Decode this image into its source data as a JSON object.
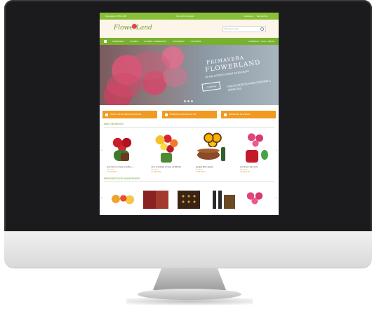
{
  "topbar": {
    "left": "Televendas (11) 5511-1000",
    "center": "Bem-vindo! Faça login",
    "right1": "Cadastre-se",
    "right2": "Meu Carrinho"
  },
  "header": {
    "logo": "FlowerLand",
    "search_placeholder": "Busque no site"
  },
  "nav": {
    "items": [
      "PRIMAVERA",
      "FLORES",
      "FLORES + PRESENTES",
      "POR PREÇO",
      "OCASIÕES"
    ],
    "right": "CARRINHO · 0 itens · R$0,00"
  },
  "banner": {
    "title1": "PRIMAVERA",
    "title2": "FLOWERLAND",
    "subtitle": "AS MELHORES FLORES DA ESTAÇÃO",
    "button": "CONFIRA",
    "side": "FRETE GRÁTIS PARA CENTRO E ZONA SUL"
  },
  "promos": [
    "FRETE GRÁTIS CENTRO E ZONA SUL",
    "PRESENTES COM ATÉ 50% OFF",
    "PRESENTES DE ATÉ 40%"
  ],
  "sections": {
    "bestsellers": "MAIS VENDIDOS",
    "birthday": "PRESENTES DE ANIVERSÁRIO"
  },
  "products": [
    {
      "name": "Amor Amor | 12 rosas vermelhas + ...",
      "old": "R$ 109,00",
      "price": "2x R$ 54,50"
    },
    {
      "name": "Amor ou Amizade 12 rosas + 6 Bolinhas",
      "old": "R$ 109,00",
      "price": "2x R$ 54,50"
    },
    {
      "name": "Energia | Bolo e alegria",
      "old": "R$ 139,00",
      "price": "2x R$ 69,50"
    },
    {
      "name": "Lírio Rosa e Sapo Cano",
      "old": "R$ 102,00",
      "price": "2x R$ 51,00"
    }
  ],
  "colors": {
    "green": "#79b12e",
    "orange": "#f09a21",
    "header_bg": "#fef5ea"
  }
}
